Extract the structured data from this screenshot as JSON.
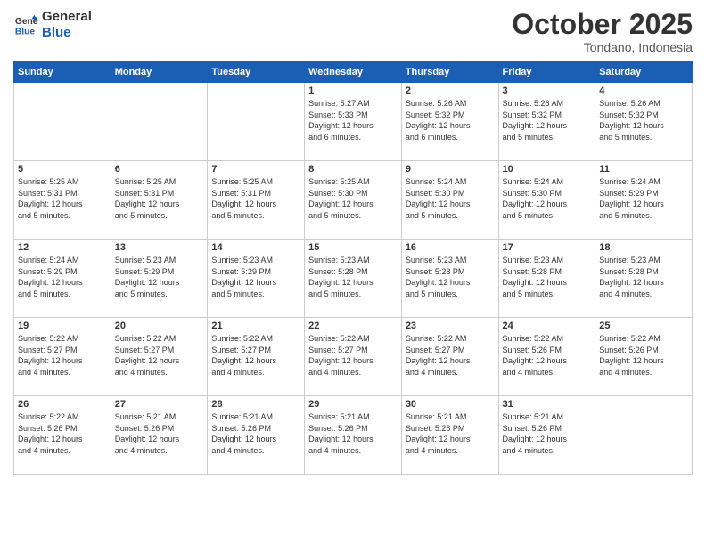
{
  "logo": {
    "line1": "General",
    "line2": "Blue"
  },
  "title": "October 2025",
  "location": "Tondano, Indonesia",
  "headers": [
    "Sunday",
    "Monday",
    "Tuesday",
    "Wednesday",
    "Thursday",
    "Friday",
    "Saturday"
  ],
  "weeks": [
    [
      {
        "day": "",
        "info": ""
      },
      {
        "day": "",
        "info": ""
      },
      {
        "day": "",
        "info": ""
      },
      {
        "day": "1",
        "info": "Sunrise: 5:27 AM\nSunset: 5:33 PM\nDaylight: 12 hours\nand 6 minutes."
      },
      {
        "day": "2",
        "info": "Sunrise: 5:26 AM\nSunset: 5:32 PM\nDaylight: 12 hours\nand 6 minutes."
      },
      {
        "day": "3",
        "info": "Sunrise: 5:26 AM\nSunset: 5:32 PM\nDaylight: 12 hours\nand 5 minutes."
      },
      {
        "day": "4",
        "info": "Sunrise: 5:26 AM\nSunset: 5:32 PM\nDaylight: 12 hours\nand 5 minutes."
      }
    ],
    [
      {
        "day": "5",
        "info": "Sunrise: 5:25 AM\nSunset: 5:31 PM\nDaylight: 12 hours\nand 5 minutes."
      },
      {
        "day": "6",
        "info": "Sunrise: 5:25 AM\nSunset: 5:31 PM\nDaylight: 12 hours\nand 5 minutes."
      },
      {
        "day": "7",
        "info": "Sunrise: 5:25 AM\nSunset: 5:31 PM\nDaylight: 12 hours\nand 5 minutes."
      },
      {
        "day": "8",
        "info": "Sunrise: 5:25 AM\nSunset: 5:30 PM\nDaylight: 12 hours\nand 5 minutes."
      },
      {
        "day": "9",
        "info": "Sunrise: 5:24 AM\nSunset: 5:30 PM\nDaylight: 12 hours\nand 5 minutes."
      },
      {
        "day": "10",
        "info": "Sunrise: 5:24 AM\nSunset: 5:30 PM\nDaylight: 12 hours\nand 5 minutes."
      },
      {
        "day": "11",
        "info": "Sunrise: 5:24 AM\nSunset: 5:29 PM\nDaylight: 12 hours\nand 5 minutes."
      }
    ],
    [
      {
        "day": "12",
        "info": "Sunrise: 5:24 AM\nSunset: 5:29 PM\nDaylight: 12 hours\nand 5 minutes."
      },
      {
        "day": "13",
        "info": "Sunrise: 5:23 AM\nSunset: 5:29 PM\nDaylight: 12 hours\nand 5 minutes."
      },
      {
        "day": "14",
        "info": "Sunrise: 5:23 AM\nSunset: 5:29 PM\nDaylight: 12 hours\nand 5 minutes."
      },
      {
        "day": "15",
        "info": "Sunrise: 5:23 AM\nSunset: 5:28 PM\nDaylight: 12 hours\nand 5 minutes."
      },
      {
        "day": "16",
        "info": "Sunrise: 5:23 AM\nSunset: 5:28 PM\nDaylight: 12 hours\nand 5 minutes."
      },
      {
        "day": "17",
        "info": "Sunrise: 5:23 AM\nSunset: 5:28 PM\nDaylight: 12 hours\nand 5 minutes."
      },
      {
        "day": "18",
        "info": "Sunrise: 5:23 AM\nSunset: 5:28 PM\nDaylight: 12 hours\nand 4 minutes."
      }
    ],
    [
      {
        "day": "19",
        "info": "Sunrise: 5:22 AM\nSunset: 5:27 PM\nDaylight: 12 hours\nand 4 minutes."
      },
      {
        "day": "20",
        "info": "Sunrise: 5:22 AM\nSunset: 5:27 PM\nDaylight: 12 hours\nand 4 minutes."
      },
      {
        "day": "21",
        "info": "Sunrise: 5:22 AM\nSunset: 5:27 PM\nDaylight: 12 hours\nand 4 minutes."
      },
      {
        "day": "22",
        "info": "Sunrise: 5:22 AM\nSunset: 5:27 PM\nDaylight: 12 hours\nand 4 minutes."
      },
      {
        "day": "23",
        "info": "Sunrise: 5:22 AM\nSunset: 5:27 PM\nDaylight: 12 hours\nand 4 minutes."
      },
      {
        "day": "24",
        "info": "Sunrise: 5:22 AM\nSunset: 5:26 PM\nDaylight: 12 hours\nand 4 minutes."
      },
      {
        "day": "25",
        "info": "Sunrise: 5:22 AM\nSunset: 5:26 PM\nDaylight: 12 hours\nand 4 minutes."
      }
    ],
    [
      {
        "day": "26",
        "info": "Sunrise: 5:22 AM\nSunset: 5:26 PM\nDaylight: 12 hours\nand 4 minutes."
      },
      {
        "day": "27",
        "info": "Sunrise: 5:21 AM\nSunset: 5:26 PM\nDaylight: 12 hours\nand 4 minutes."
      },
      {
        "day": "28",
        "info": "Sunrise: 5:21 AM\nSunset: 5:26 PM\nDaylight: 12 hours\nand 4 minutes."
      },
      {
        "day": "29",
        "info": "Sunrise: 5:21 AM\nSunset: 5:26 PM\nDaylight: 12 hours\nand 4 minutes."
      },
      {
        "day": "30",
        "info": "Sunrise: 5:21 AM\nSunset: 5:26 PM\nDaylight: 12 hours\nand 4 minutes."
      },
      {
        "day": "31",
        "info": "Sunrise: 5:21 AM\nSunset: 5:26 PM\nDaylight: 12 hours\nand 4 minutes."
      },
      {
        "day": "",
        "info": ""
      }
    ]
  ]
}
